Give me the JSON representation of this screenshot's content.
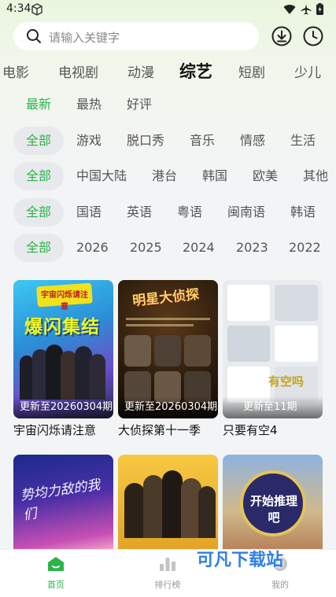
{
  "status_bar": {
    "time": "4:34"
  },
  "search": {
    "placeholder": "请输入关键字"
  },
  "categories": [
    "电影",
    "电视剧",
    "动漫",
    "综艺",
    "短剧",
    "少儿"
  ],
  "active_category": "综艺",
  "filters": {
    "sort": [
      "最新",
      "最热",
      "好评"
    ],
    "type": [
      "全部",
      "游戏",
      "脱口秀",
      "音乐",
      "情感",
      "生活"
    ],
    "region": [
      "全部",
      "中国大陆",
      "港台",
      "韩国",
      "欧美",
      "其他"
    ],
    "language": [
      "全部",
      "国语",
      "英语",
      "粤语",
      "闽南语",
      "韩语"
    ],
    "year": [
      "全部",
      "2026",
      "2025",
      "2024",
      "2023",
      "2022"
    ]
  },
  "cards": [
    {
      "title": "宇宙闪烁请注意",
      "update": "更新至20260304期",
      "poster_text": "爆闪集结",
      "poster_sub": "宇宙闪烁请注意"
    },
    {
      "title": "大侦探第十一季",
      "update": "更新至20260304期",
      "poster_text": "明星大侦探"
    },
    {
      "title": "只要有空4",
      "update": "更新至11期",
      "poster_text": "有空吗"
    },
    {
      "title": "",
      "update": "",
      "poster_text": "势均力敌的我们"
    },
    {
      "title": "",
      "update": "",
      "poster_text": ""
    },
    {
      "title": "",
      "update": "",
      "poster_text": "开始推理吧"
    }
  ],
  "bottom_nav": [
    {
      "label": "首页",
      "icon": "home-icon",
      "active": true
    },
    {
      "label": "排行榜",
      "icon": "chart-icon",
      "active": false
    },
    {
      "label": "我的",
      "icon": "profile-icon",
      "active": false
    }
  ],
  "watermark": "可凡下载站",
  "colors": {
    "accent": "#2cb34a",
    "background": "#f3f4f6",
    "watermark": "#2f7fe8"
  }
}
